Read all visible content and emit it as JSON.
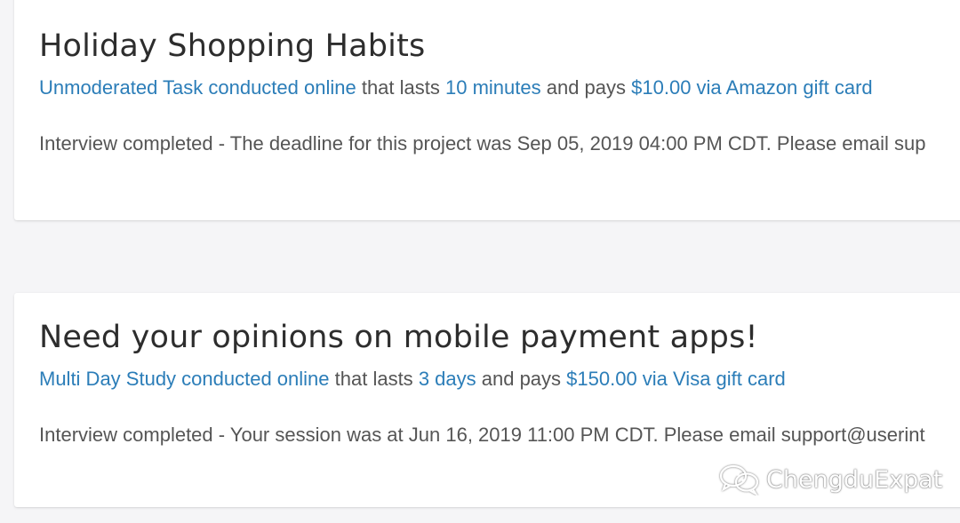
{
  "studies": [
    {
      "title": "Holiday Shopping Habits",
      "study_type": "Unmoderated Task conducted online",
      "lasts_text": " that lasts ",
      "duration": "10 minutes",
      "pays_text": " and pays ",
      "reward": "$10.00 via Amazon gift card",
      "status": "Interview completed - The deadline for this project was Sep 05, 2019 04:00 PM CDT. Please email sup"
    },
    {
      "title": "Need your opinions on mobile payment apps!",
      "study_type": "Multi Day Study conducted online",
      "lasts_text": " that lasts ",
      "duration": "3 days",
      "pays_text": " and pays ",
      "reward": "$150.00 via Visa gift card",
      "status": "Interview completed - Your session was at Jun 16, 2019 11:00 PM CDT. Please email support@userint"
    }
  ],
  "watermark": {
    "icon": "wechat-icon",
    "text": "ChengduExpat"
  },
  "colors": {
    "link": "#2b7db8",
    "text": "#555555",
    "title": "#2d2d2d",
    "background": "#f5f5f7"
  }
}
